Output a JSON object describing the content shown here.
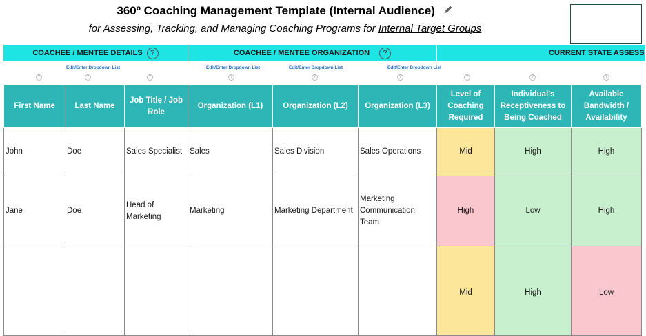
{
  "header": {
    "title": "360º Coaching Management Template (Internal Audience)",
    "subtitle_prefix": "for Assessing, Tracking, and Managing Coaching Programs for ",
    "subtitle_link": "Internal Target Groups"
  },
  "sections": [
    {
      "label": "COACHEE / MENTEE DETAILS",
      "help": "?"
    },
    {
      "label": "COACHEE / MENTEE ORGANIZATION",
      "help": "?"
    },
    {
      "label": "CURRENT STATE ASSESSMENT"
    }
  ],
  "dropdown_links": [
    "Edit/Enter Dropdown List",
    "Edit/Enter Dropdown List",
    "Edit/Enter Dropdown List",
    "Edit/Enter Dropdown List"
  ],
  "help_glyph": "?",
  "columns": [
    "First Name",
    "Last Name",
    "Job Title / Job Role",
    "Organization (L1)",
    "Organization (L2)",
    "Organization (L3)",
    "Level of Coaching Required",
    "Individual's Receptiveness to Being Coached",
    "Available Bandwidth / Availability"
  ],
  "rows": [
    {
      "first": "John",
      "last": "Doe",
      "title": "Sales Specialist",
      "org1": "Sales",
      "org2": "Sales Division",
      "org3": "Sales Operations",
      "level": "Mid",
      "recept": "High",
      "bandwidth": "High"
    },
    {
      "first": "Jane",
      "last": "Doe",
      "title": "Head of Marketing",
      "org1": "Marketing",
      "org2": "Marketing Department",
      "org3": "Marketing Communication Team",
      "level": "High",
      "recept": "Low",
      "bandwidth": "High"
    },
    {
      "first": "",
      "last": "",
      "title": "",
      "org1": "",
      "org2": "",
      "org3": "",
      "level": "Mid",
      "recept": "High",
      "bandwidth": "Low"
    }
  ],
  "colors": {
    "section_bar": "#1ee4e4",
    "header_fill": "#2eb5b5",
    "mid_fill": "#fce69a",
    "red_fill": "#f9c7cd",
    "green_fill": "#c8efce"
  }
}
